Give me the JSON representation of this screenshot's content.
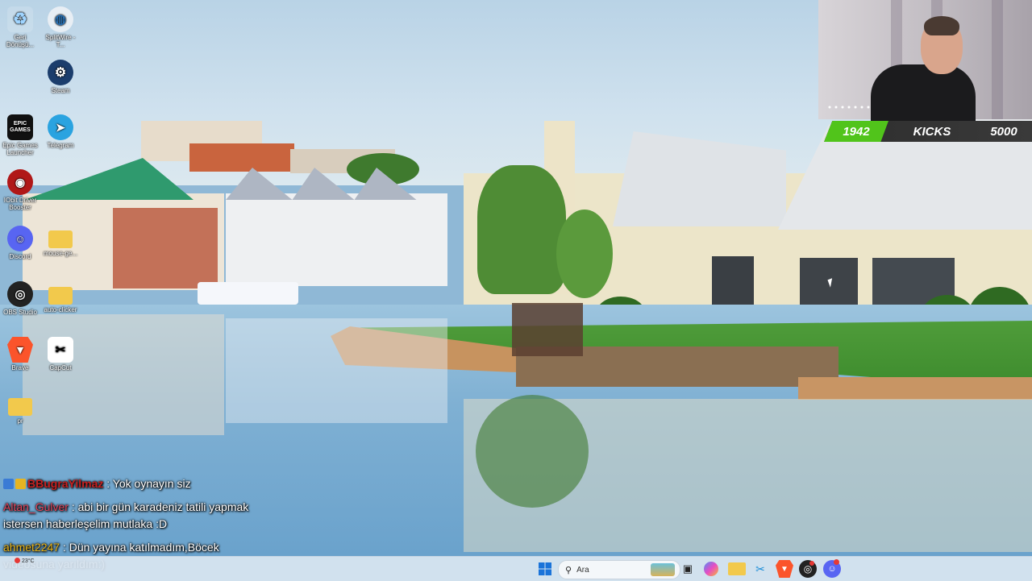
{
  "desktop": {
    "icons": [
      {
        "label": "Geri Dönüşü...",
        "icon": "recycle-bin-icon"
      },
      {
        "label": "SplitWire - T...",
        "icon": "splitwire-icon"
      },
      {
        "label": "Steam",
        "icon": "steam-icon"
      },
      {
        "label": "Epic Games Launcher",
        "icon": "epic-games-icon",
        "glyph": "EPIC GAMES"
      },
      {
        "label": "Telegram",
        "icon": "telegram-icon"
      },
      {
        "label": "IObit Driver Booster",
        "icon": "driver-booster-icon"
      },
      {
        "label": "Discord",
        "icon": "discord-icon"
      },
      {
        "label": "mouse-ge...",
        "icon": "folder-icon"
      },
      {
        "label": "OBS Studio",
        "icon": "obs-icon"
      },
      {
        "label": "auto-clicker",
        "icon": "folder-icon"
      },
      {
        "label": "Brave",
        "icon": "brave-icon"
      },
      {
        "label": "CapCut",
        "icon": "capcut-icon"
      },
      {
        "label": "pr",
        "icon": "folder-icon"
      }
    ]
  },
  "overlay": {
    "kicks_current": "1942",
    "kicks_label": "KICKS",
    "kicks_goal": "5000",
    "accent": "#51c41b"
  },
  "chat": {
    "messages": [
      {
        "user": "BBugraYilmaz",
        "text": ": Yok oynayın siz"
      },
      {
        "user": "Altan_Gulver",
        "text": ": abi bir gün karadeniz tatili yapmak istersen haberleşelim mutlaka :D"
      },
      {
        "user": "ahmet2247",
        "text": ": Dün yayına katılmadım,Böcek videosuna yarıldım:)"
      }
    ]
  },
  "taskbar": {
    "search_placeholder": "Ara",
    "weather": "23°C",
    "items": [
      "start-icon",
      "search-box",
      "task-view-icon",
      "copilot-icon",
      "file-explorer-icon",
      "snipping-tool-icon",
      "brave-icon",
      "obs-icon",
      "discord-icon"
    ]
  }
}
